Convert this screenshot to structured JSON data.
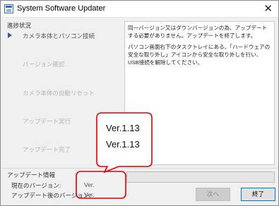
{
  "window": {
    "title": "System Software Updater",
    "close_glyph": "✕",
    "app_icon": "app-icon"
  },
  "steps": {
    "heading": "進捗状況",
    "items": [
      {
        "label": "カメラ本体とパソコン接続",
        "state": "current"
      },
      {
        "label": "バージョン確認",
        "state": "pending"
      },
      {
        "label": "カメラ本体の自動リセット",
        "state": "pending"
      },
      {
        "label": "アップデート実行",
        "state": "pending"
      },
      {
        "label": "アップデート完了",
        "state": "pending"
      }
    ]
  },
  "message": {
    "paragraph1": "同一バージョン又はダウンバージョンの為、アップデートする必要がありません。アップデートを終了します。",
    "paragraph2": "パソコン画面右下のタスクトレイにある、「ハードウェアの安全な取り外し」アイコンから安全な取り外しを行い、USB接続を解除してください。"
  },
  "update_info": {
    "heading": "アップデート情報",
    "current_version_label": "現在のバージョン:",
    "current_version_value": "Ver.",
    "after_version_label": "アップデート後のバージョン:",
    "after_version_value": "Ver."
  },
  "progress": {
    "value": 0
  },
  "buttons": {
    "next_label": "次へ",
    "exit_label": "終了"
  },
  "callout": {
    "line1": "Ver.1.13",
    "line2": "Ver.1.13",
    "color": "#e00000"
  },
  "colors": {
    "accent": "#0078d7",
    "step_marker": "#2a5ea8",
    "progress_fill": "#06b025"
  }
}
